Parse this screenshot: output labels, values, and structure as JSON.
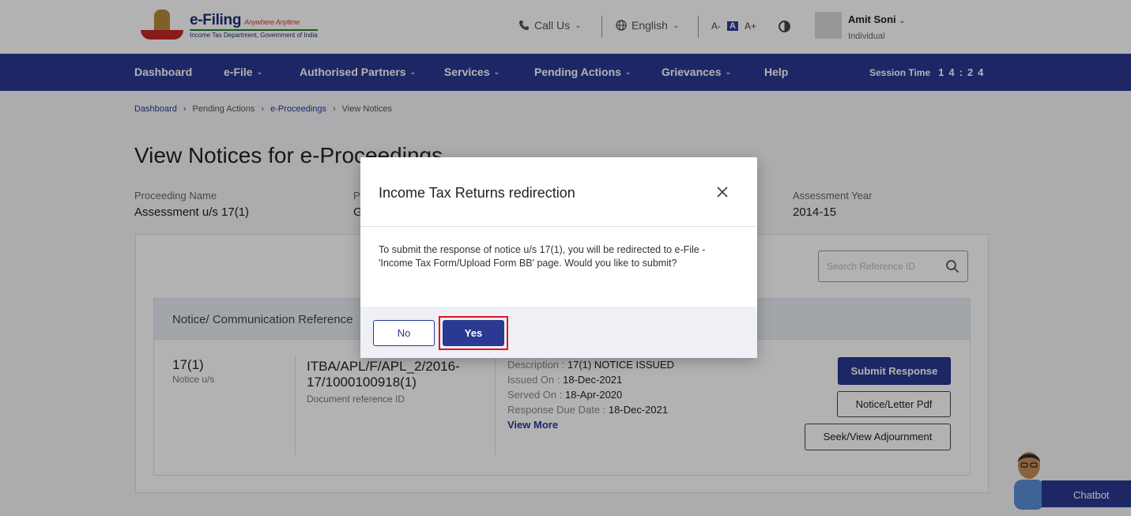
{
  "header": {
    "logo": {
      "title": "e-Filing",
      "tagline": "Anywhere Anytime",
      "subtitle": "Income Tax Department, Government of India"
    },
    "call_us": "Call Us",
    "language": "English",
    "font_controls": [
      "A-",
      "A",
      "A+"
    ],
    "user": {
      "name": "Amit Soni",
      "role": "Individual"
    }
  },
  "nav": {
    "items": [
      {
        "label": "Dashboard",
        "caret": false
      },
      {
        "label": "e-File",
        "caret": true
      },
      {
        "label": "Authorised Partners",
        "caret": true
      },
      {
        "label": "Services",
        "caret": true
      },
      {
        "label": "Pending Actions",
        "caret": true
      },
      {
        "label": "Grievances",
        "caret": true
      },
      {
        "label": "Help",
        "caret": false
      }
    ],
    "session_label": "Session Time",
    "session_digits": "14:24"
  },
  "breadcrumb": [
    "Dashboard",
    "Pending Actions",
    "e-Proceedings",
    "View Notices"
  ],
  "page": {
    "title": "View Notices for e-Proceedings",
    "proceeding_name_label": "Proceeding Name",
    "proceeding_name_value": "Assessment u/s 17(1)",
    "second_label_fragment": "P",
    "second_value_fragment": "G",
    "assessment_year_label": "Assessment Year",
    "assessment_year_value": "2014-15"
  },
  "search": {
    "placeholder": "Search Reference ID"
  },
  "table": {
    "header": "Notice/ Communication Reference",
    "row": {
      "notice_code": "17(1)",
      "notice_sub": "Notice u/s",
      "doc_ref_line1": "ITBA/APL/F/APL_2/2016-",
      "doc_ref_line2": "17/1000100918(1)",
      "doc_ref_sub": "Document reference ID",
      "description_label": "Description :",
      "description_value": "17(1) NOTICE ISSUED",
      "issued_label": "Issued On :",
      "issued_value": "18-Dec-2021",
      "served_label": "Served On :",
      "served_value": "18-Apr-2020",
      "due_label": "Response Due Date :",
      "due_value": "18-Dec-2021",
      "view_more": "View More",
      "submit_response": "Submit Response",
      "notice_pdf": "Notice/Letter Pdf",
      "seek_adjournment": "Seek/View Adjournment"
    }
  },
  "chatbot": {
    "label": "Chatbot"
  },
  "modal": {
    "title": "Income Tax Returns redirection",
    "body": "To submit the response of notice u/s 17(1), you will be redirected to e-File - 'Income Tax Form/Upload Form BB' page. Would you like to submit?",
    "no_label": "No",
    "yes_label": "Yes"
  },
  "colors": {
    "primary": "#2a3991",
    "highlight": "#e0161b",
    "overlay": "rgba(0,0,0,0.30)"
  }
}
